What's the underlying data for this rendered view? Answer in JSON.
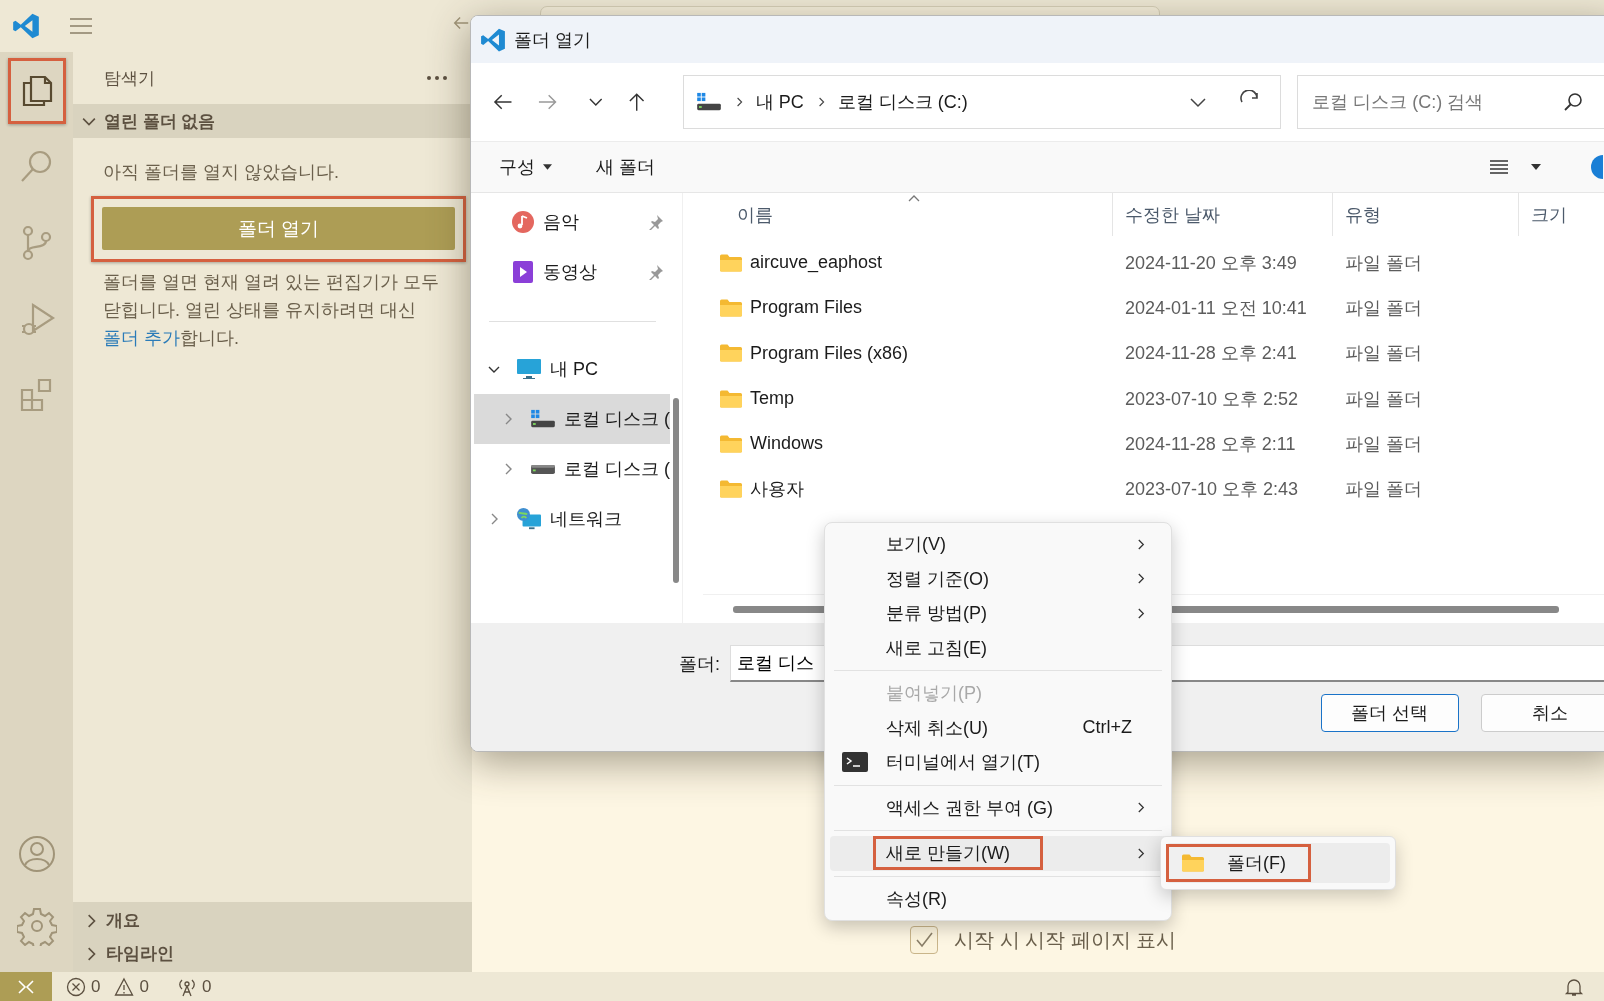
{
  "activity_bar": {
    "items": [
      {
        "kind": "explorer",
        "selected": true,
        "highlighted": true
      },
      {
        "kind": "search",
        "selected": false,
        "highlighted": false
      },
      {
        "kind": "source-control",
        "selected": false,
        "highlighted": false
      },
      {
        "kind": "run-debug",
        "selected": false,
        "highlighted": false
      },
      {
        "kind": "extensions",
        "selected": false,
        "highlighted": false
      }
    ],
    "bottom": [
      {
        "kind": "account"
      },
      {
        "kind": "settings"
      }
    ]
  },
  "sidebar": {
    "title": "탐색기",
    "section": {
      "title": "열린 폴더 없음",
      "expanded": true
    },
    "message": "아직 폴더를 열지 않았습니다.",
    "open_button": {
      "label": "폴더 열기",
      "highlighted": true
    },
    "note": {
      "before": "폴더를 열면 현재 열려 있는 편집기가 모두 닫힙니다. 열린 상태를 유지하려면 대신 ",
      "link": "폴더 추가",
      "after": "합니다."
    },
    "bottom_sections": [
      {
        "title": "개요",
        "expanded": false
      },
      {
        "title": "타임라인",
        "expanded": false
      }
    ]
  },
  "editor": {
    "start_checkbox": {
      "label": "시작 시 시작 페이지 표시",
      "checked": true
    }
  },
  "status_bar": {
    "errors": "0",
    "warnings": "0",
    "ports": "0"
  },
  "dialog": {
    "title": "폴더 열기",
    "address": [
      "내 PC",
      "로컬 디스크 (C:)"
    ],
    "search": {
      "placeholder": "로컬 디스크 (C:) 검색"
    },
    "toolbar": [
      {
        "label": "구성",
        "menu": true
      },
      {
        "label": "새 폴더",
        "menu": false
      }
    ],
    "quick_access": [
      {
        "label": "음악",
        "kind": "music",
        "pinned": true
      },
      {
        "label": "동영상",
        "kind": "video",
        "pinned": true
      }
    ],
    "tree": [
      {
        "label": "내 PC",
        "kind": "pc",
        "expanded": true,
        "selected": false,
        "children": [
          {
            "label": "로컬 디스크 (",
            "kind": "system-drive",
            "expanded": false,
            "selected": true
          },
          {
            "label": "로컬 디스크 (",
            "kind": "drive",
            "expanded": false,
            "selected": false
          }
        ]
      },
      {
        "label": "네트워크",
        "kind": "network",
        "expanded": false,
        "selected": false
      }
    ],
    "columns": [
      {
        "label": "이름",
        "sorted": true
      },
      {
        "label": "수정한 날짜",
        "sorted": false
      },
      {
        "label": "유형",
        "sorted": false
      },
      {
        "label": "크기",
        "sorted": false
      }
    ],
    "rows": [
      {
        "name": "aircuve_eaphost",
        "date": "2024-11-20 오후 3:49",
        "type": "파일 폴더"
      },
      {
        "name": "Program Files",
        "date": "2024-01-11 오전 10:41",
        "type": "파일 폴더"
      },
      {
        "name": "Program Files (x86)",
        "date": "2024-11-28 오후 2:41",
        "type": "파일 폴더"
      },
      {
        "name": "Temp",
        "date": "2023-07-10 오후 2:52",
        "type": "파일 폴더"
      },
      {
        "name": "Windows",
        "date": "2024-11-28 오후 2:11",
        "type": "파일 폴더"
      },
      {
        "name": "사용자",
        "date": "2023-07-10 오후 2:43",
        "type": "파일 폴더"
      }
    ],
    "folder_label": "폴더:",
    "folder_value": "로컬 디스",
    "buttons": [
      {
        "label": "폴더 선택",
        "kind": "primary"
      },
      {
        "label": "취소",
        "kind": "secondary"
      }
    ]
  },
  "context_menu": {
    "items": [
      {
        "kind": "item",
        "label": "보기(V)",
        "submenu": true,
        "disabled": false,
        "selected": false,
        "highlighted": false
      },
      {
        "kind": "item",
        "label": "정렬 기준(O)",
        "submenu": true,
        "disabled": false,
        "selected": false,
        "highlighted": false
      },
      {
        "kind": "item",
        "label": "분류 방법(P)",
        "submenu": true,
        "disabled": false,
        "selected": false,
        "highlighted": false
      },
      {
        "kind": "item",
        "label": "새로 고침(E)",
        "submenu": false,
        "disabled": false,
        "selected": false,
        "highlighted": false
      },
      {
        "kind": "separator"
      },
      {
        "kind": "item",
        "label": "붙여넣기(P)",
        "submenu": false,
        "disabled": true,
        "selected": false,
        "highlighted": false
      },
      {
        "kind": "item",
        "label": "삭제 취소(U)",
        "shortcut": "Ctrl+Z",
        "submenu": false,
        "disabled": false,
        "selected": false,
        "highlighted": false
      },
      {
        "kind": "icon-item",
        "label": "터미널에서 열기(T)",
        "submenu": false,
        "disabled": false,
        "selected": false,
        "highlighted": false
      },
      {
        "kind": "separator"
      },
      {
        "kind": "item",
        "label": "액세스 권한 부여 (G)",
        "submenu": true,
        "disabled": false,
        "selected": false,
        "highlighted": false
      },
      {
        "kind": "separator"
      },
      {
        "kind": "item",
        "label": "새로 만들기(W)",
        "submenu": true,
        "disabled": false,
        "selected": true,
        "highlighted": true
      },
      {
        "kind": "separator"
      },
      {
        "kind": "item",
        "label": "속성(R)",
        "submenu": false,
        "disabled": false,
        "selected": false,
        "highlighted": false
      }
    ],
    "submenu": [
      {
        "label": "폴더(F)",
        "selected": true,
        "highlighted": true
      }
    ]
  }
}
